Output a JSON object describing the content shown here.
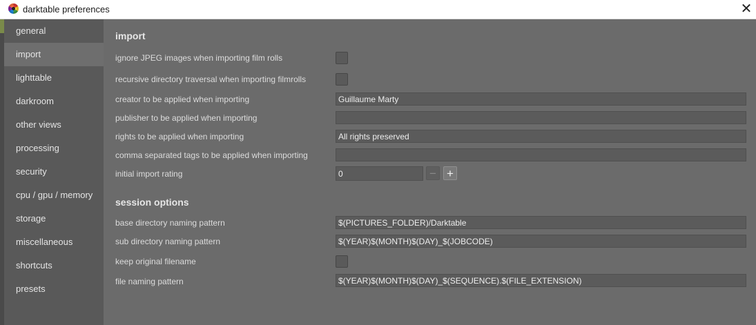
{
  "window": {
    "title": "darktable preferences",
    "app_icon": "darktable-logo-icon",
    "close_glyph": "✕"
  },
  "sidebar": {
    "items": [
      {
        "label": "general",
        "active": false
      },
      {
        "label": "import",
        "active": true
      },
      {
        "label": "lighttable",
        "active": false
      },
      {
        "label": "darkroom",
        "active": false
      },
      {
        "label": "other views",
        "active": false
      },
      {
        "label": "processing",
        "active": false
      },
      {
        "label": "security",
        "active": false
      },
      {
        "label": "cpu / gpu / memory",
        "active": false
      },
      {
        "label": "storage",
        "active": false
      },
      {
        "label": "miscellaneous",
        "active": false
      },
      {
        "label": "shortcuts",
        "active": false
      },
      {
        "label": "presets",
        "active": false
      }
    ]
  },
  "import": {
    "title": "import",
    "ignore_jpeg": {
      "label": "ignore JPEG images when importing film rolls",
      "checked": false
    },
    "recursive": {
      "label": "recursive directory traversal when importing filmrolls",
      "checked": false
    },
    "creator": {
      "label": "creator to be applied when importing",
      "value": "Guillaume Marty"
    },
    "publisher": {
      "label": "publisher to be applied when importing",
      "value": ""
    },
    "rights": {
      "label": "rights to be applied when importing",
      "value": "All rights preserved"
    },
    "tags": {
      "label": "comma separated tags to be applied when importing",
      "value": ""
    },
    "rating": {
      "label": "initial import rating",
      "value": "0",
      "minus": "−",
      "plus": "+"
    }
  },
  "session": {
    "title": "session options",
    "base_dir": {
      "label": "base directory naming pattern",
      "value": "$(PICTURES_FOLDER)/Darktable"
    },
    "sub_dir": {
      "label": "sub directory naming pattern",
      "value": "$(YEAR)$(MONTH)$(DAY)_$(JOBCODE)"
    },
    "keep_filename": {
      "label": "keep original filename",
      "checked": false
    },
    "file_pattern": {
      "label": "file naming pattern",
      "value": "$(YEAR)$(MONTH)$(DAY)_$(SEQUENCE).$(FILE_EXTENSION)"
    }
  },
  "colors": {
    "background": "#6b6b6b",
    "sidebar": "#595959",
    "sidebar_active": "#6e6e6e",
    "text": "#dcdcdc"
  }
}
